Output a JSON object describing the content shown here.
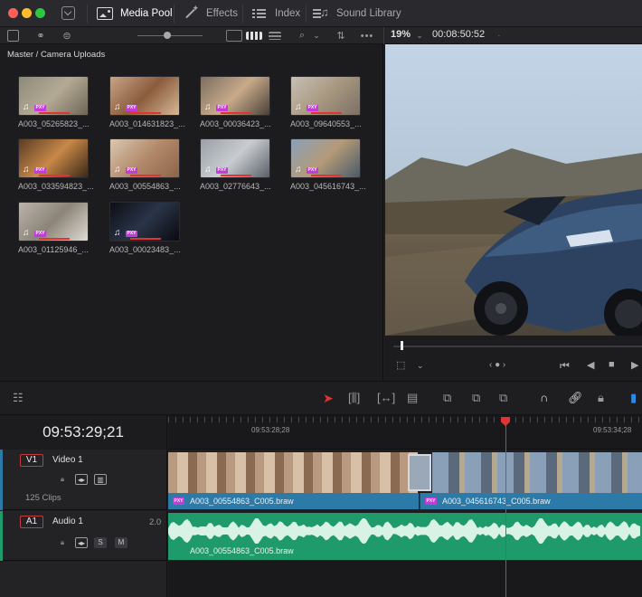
{
  "titlebar": {
    "media_pool": "Media Pool",
    "effects": "Effects",
    "index": "Index",
    "sound_library": "Sound Library"
  },
  "viewer_toolbar": {
    "zoom": "19%",
    "timecode": "00:08:50:52"
  },
  "media_pool": {
    "breadcrumb": "Master / Camera Uploads",
    "clips": [
      {
        "name": "A003_05265823_...",
        "icon": "music-note-icon",
        "proxy": "PXY",
        "colors": [
          "#8c8a7c",
          "#b4aa94",
          "#6e6656"
        ]
      },
      {
        "name": "A003_014631823_...",
        "icon": "music-note-icon",
        "proxy": "PXY",
        "colors": [
          "#c8a488",
          "#8a5c3c",
          "#d8b898"
        ]
      },
      {
        "name": "A003_00036423_...",
        "icon": "music-note-icon",
        "proxy": "PXY",
        "colors": [
          "#7c6e60",
          "#c8aa8a",
          "#4a4038"
        ]
      },
      {
        "name": "A003_09640553_...",
        "icon": "music-note-icon",
        "proxy": "PXY",
        "colors": [
          "#c8c0b4",
          "#a89880",
          "#7c7064"
        ]
      },
      {
        "name": "A003_033594823_...",
        "icon": "music-note-icon",
        "proxy": "PXY",
        "colors": [
          "#5a3c24",
          "#c88848",
          "#3a2818"
        ]
      },
      {
        "name": "A003_00554863_...",
        "icon": "music-note-icon",
        "proxy": "PXY",
        "colors": [
          "#d8c8b0",
          "#b48a6c",
          "#8c6448"
        ]
      },
      {
        "name": "A003_02776643_...",
        "icon": "music-note-icon",
        "proxy": "PXY",
        "colors": [
          "#9aa0a8",
          "#c8ccd0",
          "#5a6068"
        ]
      },
      {
        "name": "A003_045616743_...",
        "icon": "music-note-icon",
        "proxy": "PXY",
        "colors": [
          "#8aa0b8",
          "#b49a78",
          "#4a5a6a"
        ]
      },
      {
        "name": "A003_01125946_...",
        "icon": "music-note-icon",
        "proxy": "PXY",
        "colors": [
          "#bab4ac",
          "#8c8478",
          "#e0dcd4"
        ]
      },
      {
        "name": "A003_00023483_...",
        "icon": "music-note-icon",
        "proxy": "PXY",
        "colors": [
          "#0c0e14",
          "#2a3448",
          "#0a0a10"
        ]
      }
    ]
  },
  "timeline": {
    "timecode": "09:53:29;21",
    "ruler_labels": [
      "09:53:28;28",
      "09:53:34;28"
    ],
    "video_track": {
      "id": "V1",
      "name": "Video 1",
      "clip_count": "125 Clips",
      "clip_a": "A003_00554863_C005.braw",
      "clip_b": "A003_045616743_C005.braw",
      "proxy": "PXY"
    },
    "audio_track": {
      "id": "A1",
      "name": "Audio 1",
      "channels": "2.0",
      "solo": "S",
      "mute": "M",
      "clip": "A003_00554863_C005.braw"
    }
  },
  "colors": {
    "accent_red": "#e33232",
    "video_clip": "#2b7aa8",
    "audio_clip": "#1f9a6a",
    "proxy_badge": "#c53ad8"
  }
}
